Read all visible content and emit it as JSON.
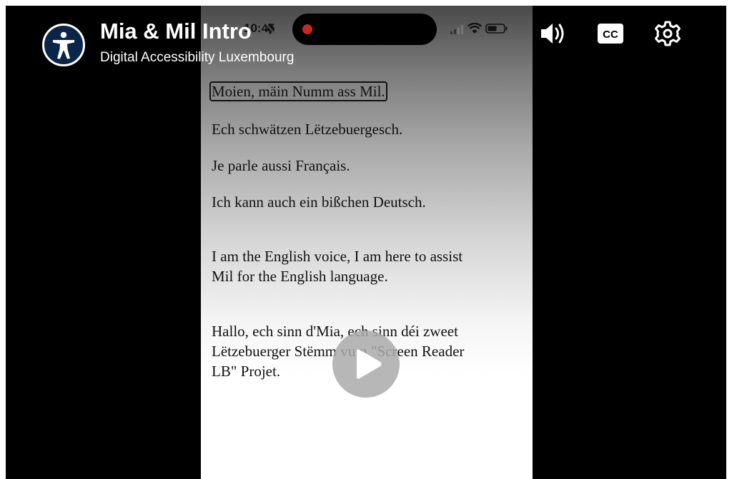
{
  "video": {
    "title": "Mia & Mil Intro",
    "channel": "Digital Accessibility Luxembourg"
  },
  "phone": {
    "status_time": "10:45",
    "lines": [
      "Moien, mäin Numm ass Mil.",
      "Ech schwätzen Lëtzebuergesch.",
      "Je parle aussi Français.",
      "Ich kann auch ein bißchen Deutsch.",
      "I am the English voice, I am here to assist",
      "Mil for the English language.",
      "Hallo, ech sinn d'Mia, ech sinn déi zweet",
      "Lëtzebuerger Stëmm vum \"Screen Reader",
      "LB\" Projet."
    ]
  },
  "controls": {
    "cc_label": "CC",
    "icons": [
      "accessibility-icon",
      "volume-icon",
      "cc-icon",
      "settings-gear-icon",
      "play-icon"
    ]
  },
  "colors": {
    "player_bg": "#000000",
    "logo_bg": "#0b2549",
    "play_button": "#aaaaaa"
  }
}
